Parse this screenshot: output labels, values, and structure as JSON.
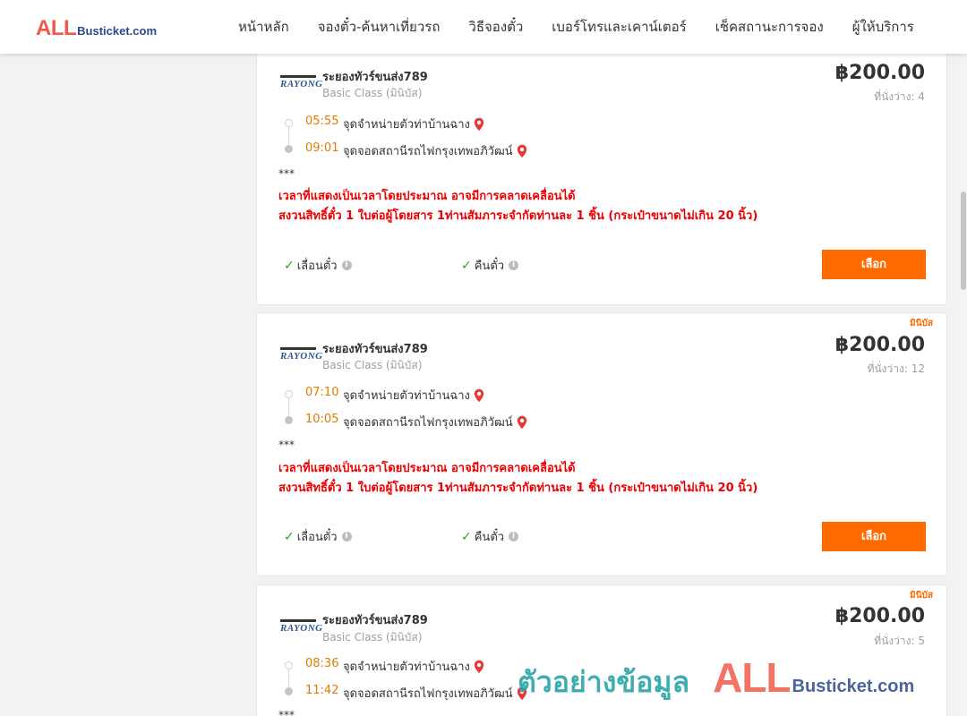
{
  "header": {
    "logo_all": "ALL",
    "logo_rest": "Busticket.com",
    "menu": [
      "หน้าหลัก",
      "จองตั๋ว-ค้นหาเที่ยวรถ",
      "วิธีจองตั๋ว",
      "เบอร์โทรและเคาน์เตอร์",
      "เช็คสถานะการจอง",
      "ผู้ให้บริการ"
    ]
  },
  "trips": [
    {
      "badge": "",
      "operator_logo": "RAYONG",
      "operator": "ระยองทัวร์ขนส่ง789",
      "class": "Basic Class (มินิบัส)",
      "price": "฿200.00",
      "seats": "ที่นั่งว่าง: 4",
      "depart_time": "05:55",
      "depart_stop": "จุดจำหน่ายตัวท่าบ้านฉาง",
      "arrive_time": "09:01",
      "arrive_stop": "จุดจอดสถานีรถไฟกรุงเทพอภิวัฒน์",
      "stars": "***",
      "note1": "เวลาที่แสดงเป็นเวลาโดยประมาณ อาจมีการคลาดเคลื่อนได้",
      "note2": "สงวนสิทธิ์ตั๋ว 1 ใบต่อผู้โดยสาร 1ท่านสัมภาระจำกัดท่านละ 1 ชิ้น (กระเป๋าขนาดไม่เกิน 20 นิ้ว)",
      "feature1": "เลื่อนตั๋ว",
      "feature2": "คืนตั๋ว",
      "select": "เลือก"
    },
    {
      "badge": "มินิบัส",
      "operator_logo": "RAYONG",
      "operator": "ระยองทัวร์ขนส่ง789",
      "class": "Basic Class (มินิบัส)",
      "price": "฿200.00",
      "seats": "ที่นั่งว่าง: 12",
      "depart_time": "07:10",
      "depart_stop": "จุดจำหน่ายตัวท่าบ้านฉาง",
      "arrive_time": "10:05",
      "arrive_stop": "จุดจอดสถานีรถไฟกรุงเทพอภิวัฒน์",
      "stars": "***",
      "note1": "เวลาที่แสดงเป็นเวลาโดยประมาณ อาจมีการคลาดเคลื่อนได้",
      "note2": "สงวนสิทธิ์ตั๋ว 1 ใบต่อผู้โดยสาร 1ท่านสัมภาระจำกัดท่านละ 1 ชิ้น (กระเป๋าขนาดไม่เกิน 20 นิ้ว)",
      "feature1": "เลื่อนตั๋ว",
      "feature2": "คืนตั๋ว",
      "select": "เลือก"
    },
    {
      "badge": "มินิบัส",
      "operator_logo": "RAYONG",
      "operator": "ระยองทัวร์ขนส่ง789",
      "class": "Basic Class (มินิบัส)",
      "price": "฿200.00",
      "seats": "ที่นั่งว่าง: 5",
      "depart_time": "08:36",
      "depart_stop": "จุดจำหน่ายตัวท่าบ้านฉาง",
      "arrive_time": "11:42",
      "arrive_stop": "จุดจอดสถานีรถไฟกรุงเทพอภิวัฒน์",
      "stars": "***"
    }
  ],
  "watermark": {
    "text": "ตัวอย่างข้อมูล",
    "all": "ALL",
    "rest": "Busticket.com"
  },
  "colors": {
    "accent": "#ff6a00",
    "time": "#e07b00",
    "note": "#ee0000",
    "check": "#2ca02c"
  }
}
